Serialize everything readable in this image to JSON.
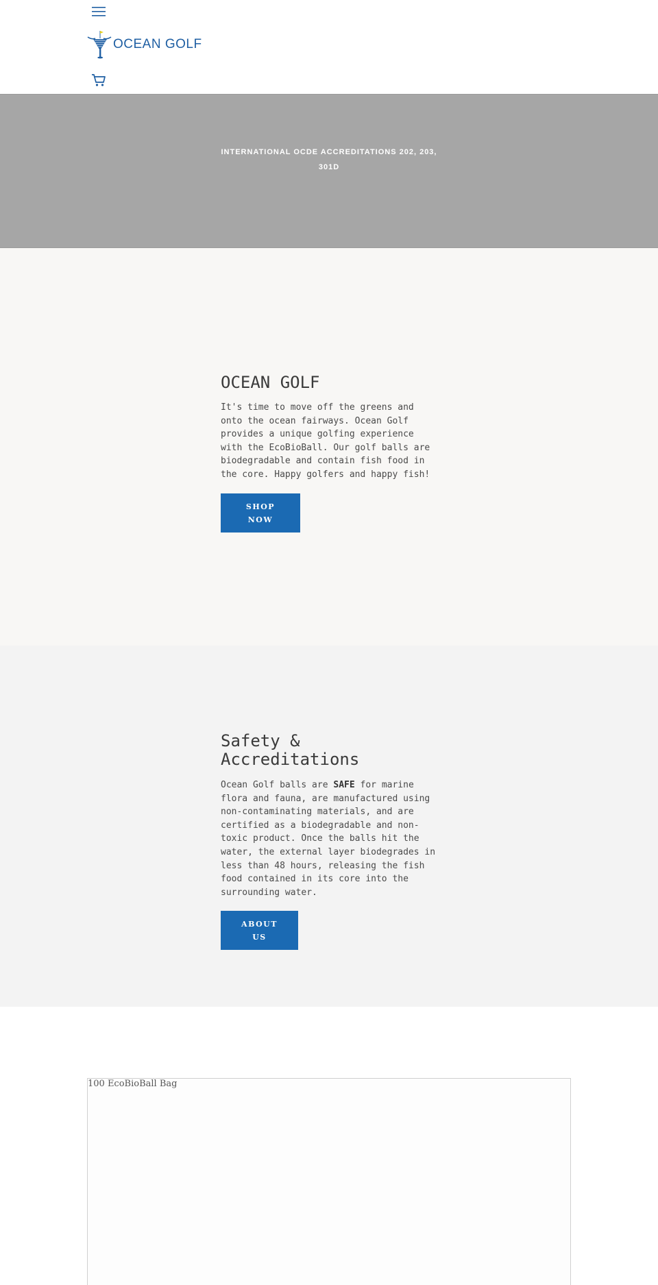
{
  "header": {
    "menu_icon": "hamburger-menu-icon",
    "logo_text": "OCEAN GOLF",
    "cart_icon": "shopping-cart-icon"
  },
  "banner": {
    "line1": "INTERNATIONAL OCDE ACCREDITATIONS 202, 203,",
    "line2": "301D"
  },
  "intro": {
    "heading": "OCEAN GOLF",
    "text": "It's time to move off the greens and onto the ocean fairways. Ocean Golf provides a unique golfing experience with the EcoBioBall. Our golf balls are biodegradable and contain fish food in the core. Happy golfers and happy fish!",
    "button_line1": "SHOP",
    "button_line2": "NOW"
  },
  "safety": {
    "heading": "Safety & Accreditations",
    "text_before": "Ocean Golf balls are ",
    "text_bold": "SAFE",
    "text_after": " for marine flora and fauna, are manufactured using non-contaminating materials, and are certified as a biodegradable and non-toxic product. Once the balls hit the water, the external layer biodegrades in less than 48 hours, releasing the fish food contained in its core into the surrounding water.",
    "button_line1": "ABOUT",
    "button_line2": "US"
  },
  "product": {
    "title": "100 EcoBioBall Bag"
  },
  "colors": {
    "brand_blue": "#1b6ab3",
    "banner_gray": "#a6a6a6",
    "intro_bg": "#f8f7f5",
    "safety_bg": "#f3f3f3"
  }
}
